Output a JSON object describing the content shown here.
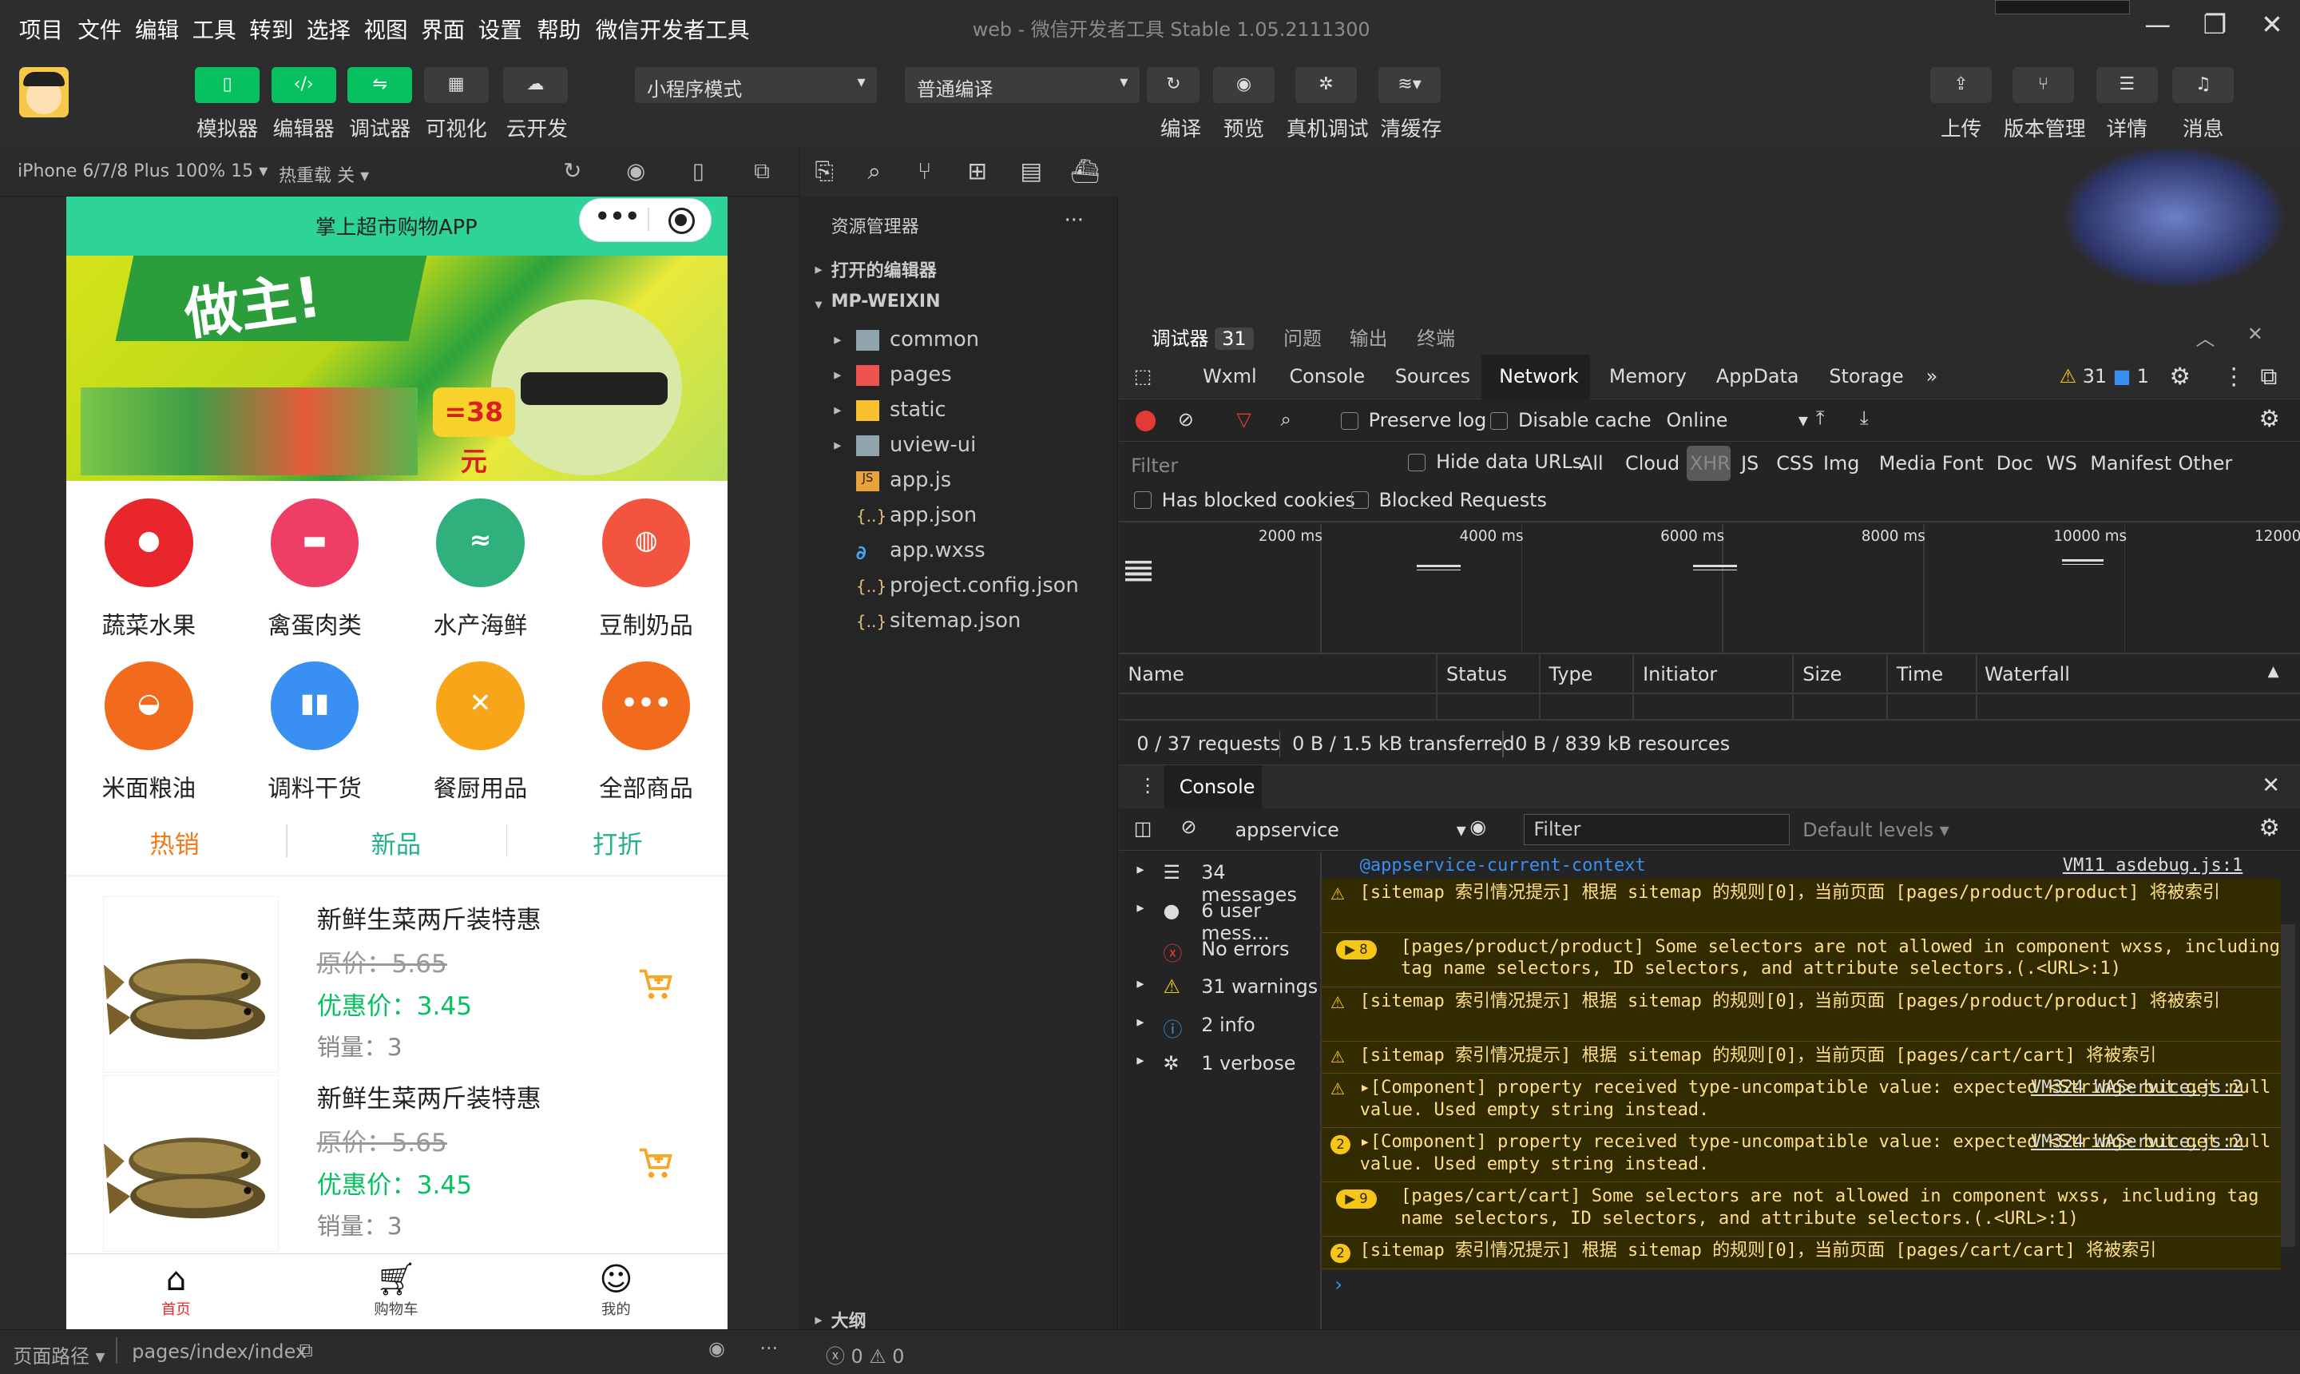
{
  "menu": {
    "items": [
      "项目",
      "文件",
      "编辑",
      "工具",
      "转到",
      "选择",
      "视图",
      "界面",
      "设置",
      "帮助",
      "微信开发者工具"
    ],
    "window_title": "web - 微信开发者工具 Stable 1.05.2111300"
  },
  "toolbar": {
    "left": [
      "模拟器",
      "编辑器",
      "调试器",
      "可视化",
      "云开发"
    ],
    "mode": "小程序模式",
    "compile_mode": "普通编译",
    "mid": [
      "编译",
      "预览",
      "真机调试",
      "清缓存"
    ],
    "right": [
      "上传",
      "版本管理",
      "详情",
      "消息"
    ]
  },
  "simbar": {
    "device": "iPhone 6/7/8 Plus 100% 15",
    "hotreload": "热重载 关"
  },
  "app": {
    "title": "掌上超市购物APP",
    "categories": [
      {
        "label": "蔬菜水果",
        "color": "#e8262c"
      },
      {
        "label": "禽蛋肉类",
        "color": "#ee3e66"
      },
      {
        "label": "水产海鲜",
        "color": "#2fb07d"
      },
      {
        "label": "豆制奶品",
        "color": "#f35440"
      },
      {
        "label": "米面粮油",
        "color": "#f26a1b"
      },
      {
        "label": "调料干货",
        "color": "#3a8ff2"
      },
      {
        "label": "餐厨用品",
        "color": "#f9a51a"
      },
      {
        "label": "全部商品",
        "color": "#f26a1b"
      }
    ],
    "tabs": [
      "热销",
      "新品",
      "打折"
    ],
    "products": [
      {
        "name": "新鲜生菜两斤装特惠",
        "old": "原价：5.65",
        "new": "优惠价：3.45",
        "sales": "销量：3"
      },
      {
        "name": "新鲜生菜两斤装特惠",
        "old": "原价：5.65",
        "new": "优惠价：3.45",
        "sales": "销量：3"
      }
    ],
    "tabbar": [
      "首页",
      "购物车",
      "我的"
    ]
  },
  "status": {
    "path_label": "页面路径",
    "path": "pages/index/index",
    "counts": "ⓧ 0 ⚠ 0"
  },
  "explorer": {
    "title": "资源管理器",
    "open_editors": "打开的编辑器",
    "root": "MP-WEIXIN",
    "items": [
      "common",
      "pages",
      "static",
      "uview-ui",
      "app.js",
      "app.json",
      "app.wxss",
      "project.config.json",
      "sitemap.json"
    ],
    "outline": "大纲"
  },
  "devtools": {
    "top_tabs": [
      "调试器",
      "问题",
      "输出",
      "终端"
    ],
    "badge": "31",
    "panels": [
      "Wxml",
      "Console",
      "Sources",
      "Network",
      "Memory",
      "AppData",
      "Storage"
    ],
    "warn": "31",
    "info": "1",
    "network": {
      "preserve": "Preserve log",
      "disable_cache": "Disable cache",
      "online": "Online",
      "filter": "Filter",
      "hide_data": "Hide data URLs",
      "types": [
        "All",
        "Cloud",
        "XHR",
        "JS",
        "CSS",
        "Img",
        "Media",
        "Font",
        "Doc",
        "WS",
        "Manifest",
        "Other"
      ],
      "blocked_cookies": "Has blocked cookies",
      "blocked_req": "Blocked Requests",
      "ticks": [
        "2000 ms",
        "4000 ms",
        "6000 ms",
        "8000 ms",
        "10000 ms",
        "12000"
      ],
      "cols": [
        "Name",
        "Status",
        "Type",
        "Initiator",
        "Size",
        "Time",
        "Waterfall"
      ],
      "summary": [
        "0 / 37 requests",
        "0 B / 1.5 kB transferred",
        "0 B / 839 kB resources"
      ]
    },
    "console": {
      "tab": "Console",
      "context": "appservice",
      "filter": "Filter",
      "levels": "Default levels",
      "side": [
        "34 messages",
        "6 user mess...",
        "No errors",
        "31 warnings",
        "2 info",
        "1 verbose"
      ],
      "top_line": "@appservice-current-context",
      "top_link": "VM11 asdebug.js:1",
      "messages": [
        {
          "t": "[sitemap 索引情况提示] 根据 sitemap 的规则[0]，当前页面 [pages/product/product] 将被索引",
          "icon": "⚠"
        },
        {
          "t": "[pages/product/product] Some selectors are not allowed in component wxss, including tag name selectors, ID selectors, and attribute selectors.(.<URL>:1)",
          "icon": "badge",
          "b": "8"
        },
        {
          "t": "[sitemap 索引情况提示] 根据 sitemap 的规则[0]，当前页面 [pages/product/product] 将被索引",
          "icon": "⚠"
        },
        {
          "t": "[sitemap 索引情况提示] 根据 sitemap 的规则[0]，当前页面 [pages/cart/cart] 将被索引",
          "icon": "⚠"
        },
        {
          "t": "▸[Component] property received type-uncompatible value: expected <String> but get null value. Used empty string instead.",
          "icon": "⚠",
          "link": "VM324 WAService.js:2"
        },
        {
          "t": "▸[Component] property received type-uncompatible value: expected <String> but get null value. Used empty string instead.",
          "icon": "2",
          "link": "VM324 WAService.js:2"
        },
        {
          "t": "[pages/cart/cart] Some selectors are not allowed in component wxss, including tag name selectors, ID selectors, and attribute selectors.(.<URL>:1)",
          "icon": "badge",
          "b": "9"
        },
        {
          "t": "[sitemap 索引情况提示] 根据 sitemap 的规则[0]，当前页面 [pages/cart/cart] 将被索引",
          "icon": "2"
        }
      ]
    }
  }
}
